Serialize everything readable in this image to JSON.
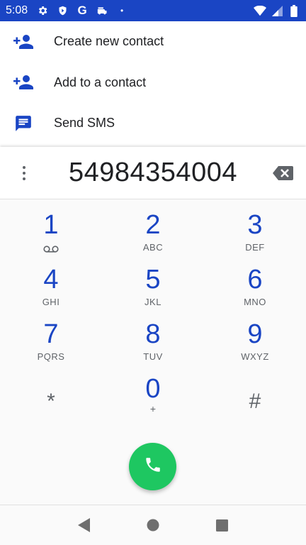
{
  "status_bar": {
    "time": "5:08",
    "left_icons": [
      "gear-icon",
      "shield-icon",
      "google-icon",
      "car-icon",
      "dot-icon"
    ],
    "right_icons": [
      "wifi-icon",
      "signal-icon",
      "battery-icon"
    ],
    "google_letter": "G",
    "dot": "•",
    "bg_color": "#1a45c4"
  },
  "actions": [
    {
      "label": "Create new contact",
      "icon": "add-person-icon"
    },
    {
      "label": "Add to a contact",
      "icon": "add-person-icon"
    },
    {
      "label": "Send SMS",
      "icon": "message-icon"
    }
  ],
  "dialer": {
    "number": "54984354004",
    "keys": [
      [
        {
          "digit": "1",
          "letters": ""
        },
        {
          "digit": "2",
          "letters": "ABC"
        },
        {
          "digit": "3",
          "letters": "DEF"
        }
      ],
      [
        {
          "digit": "4",
          "letters": "GHI"
        },
        {
          "digit": "5",
          "letters": "JKL"
        },
        {
          "digit": "6",
          "letters": "MNO"
        }
      ],
      [
        {
          "digit": "7",
          "letters": "PQRS"
        },
        {
          "digit": "8",
          "letters": "TUV"
        },
        {
          "digit": "9",
          "letters": "WXYZ"
        }
      ],
      [
        {
          "digit": "*",
          "letters": ""
        },
        {
          "digit": "0",
          "letters": "+"
        },
        {
          "digit": "#",
          "letters": ""
        }
      ]
    ],
    "accent_color": "#1a45c4",
    "call_color": "#1ec761"
  },
  "nav_bar": {
    "buttons": [
      "back-icon",
      "home-icon",
      "recents-icon"
    ]
  }
}
